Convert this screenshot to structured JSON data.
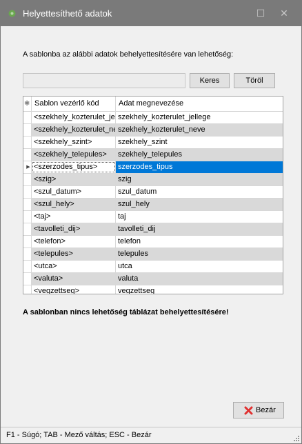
{
  "window": {
    "title": "Helyettesíthető adatok",
    "maximize_glyph": "☐",
    "close_glyph": "✕",
    "icon": "app-icon"
  },
  "intro_text": "A sablonba az alábbi adatok behelyettesítésére van lehetőség:",
  "search": {
    "value": "",
    "keres_label": "Keres",
    "torol_label": "Töröl"
  },
  "grid": {
    "indicator_header": "✱",
    "columns": [
      "Sablon vezérlő kód",
      "Adat megnevezése"
    ],
    "selected_row_index": 4,
    "rows": [
      {
        "code": "<szekhely_kozterulet_jellege>",
        "name": "szekhely_kozterulet_jellege"
      },
      {
        "code": "<szekhely_kozterulet_neve>",
        "name": "szekhely_kozterulet_neve"
      },
      {
        "code": "<szekhely_szint>",
        "name": "szekhely_szint"
      },
      {
        "code": "<szekhely_telepules>",
        "name": "szekhely_telepules"
      },
      {
        "code": "<szerzodes_tipus>",
        "name": "szerzodes_tipus"
      },
      {
        "code": "<szig>",
        "name": "szig"
      },
      {
        "code": "<szul_datum>",
        "name": "szul_datum"
      },
      {
        "code": "<szul_hely>",
        "name": "szul_hely"
      },
      {
        "code": "<taj>",
        "name": "taj"
      },
      {
        "code": "<tavolleti_dij>",
        "name": "tavolleti_dij"
      },
      {
        "code": "<telefon>",
        "name": "telefon"
      },
      {
        "code": "<telepules>",
        "name": "telepules"
      },
      {
        "code": "<utca>",
        "name": "utca"
      },
      {
        "code": "<valuta>",
        "name": "valuta"
      },
      {
        "code": "<vegzettseg>",
        "name": "vegzettseg"
      }
    ]
  },
  "notice": "A sablonban nincs lehetőség táblázat behelyettesítésére!",
  "close_button": {
    "label": "Bezár",
    "icon": "red-x-icon"
  },
  "status_bar": "F1 - Súgó; TAB - Mező váltás; ESC - Bezár",
  "colors": {
    "selection": "#0078d7",
    "titlebar": "#7a7a7a",
    "alt_row": "#d9d9d9"
  }
}
